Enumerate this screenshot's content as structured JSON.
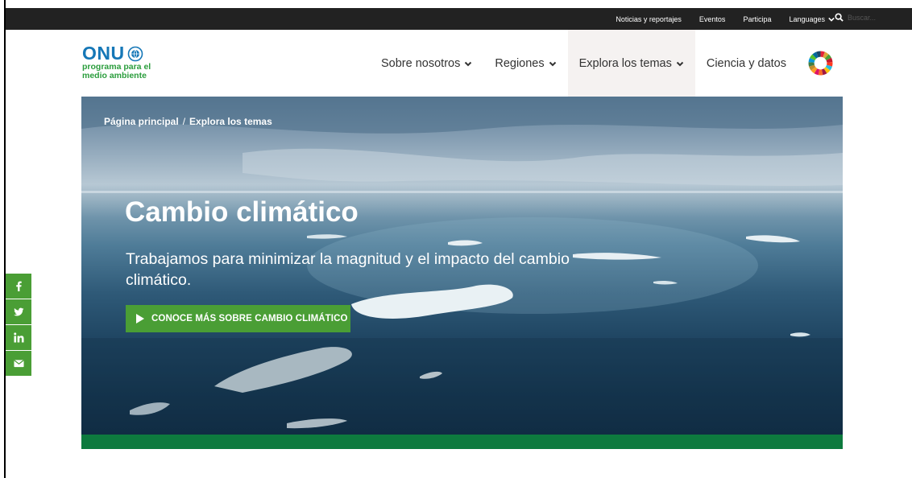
{
  "topbar": {
    "links": [
      "Noticias y reportajes",
      "Eventos",
      "Participa"
    ],
    "languages_label": "Languages",
    "search_placeholder": "Buscar..."
  },
  "header": {
    "logo_title": "ONU",
    "logo_line1": "programa para el",
    "logo_line2": "medio ambiente",
    "nav": [
      "Sobre nosotros",
      "Regiones",
      "Explora los temas",
      "Ciencia y datos"
    ]
  },
  "hero": {
    "breadcrumb_home": "Página principal",
    "breadcrumb_sep": "/",
    "breadcrumb_current": "Explora los temas",
    "title": "Cambio climático",
    "description": "Trabajamos para minimizar la magnitud y el impacto del cambio climático.",
    "cta_label": "CONOCE MÁS SOBRE CAMBIO CLIMÁTICO"
  },
  "social": [
    "facebook-icon",
    "twitter-icon",
    "linkedin-icon",
    "email-icon"
  ],
  "colors": {
    "topbar_bg": "#222222",
    "brand_blue": "#1577b7",
    "brand_green": "#2a9d3c",
    "cta_green": "#4a9e35",
    "footer_green": "#0d7a3e"
  }
}
